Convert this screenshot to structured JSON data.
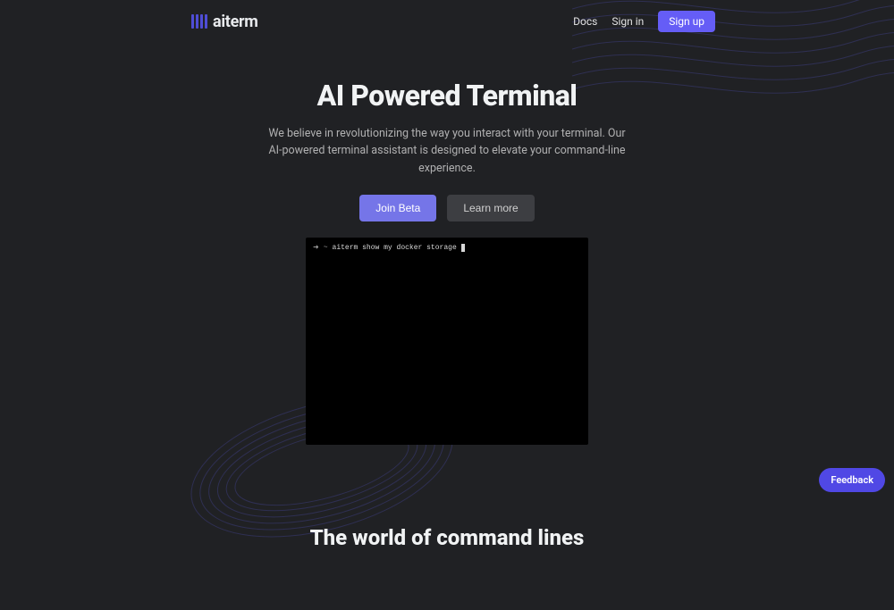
{
  "header": {
    "brand": "aiterm",
    "nav": {
      "docs": "Docs",
      "signin": "Sign in",
      "signup": "Sign up"
    }
  },
  "hero": {
    "title": "AI Powered Terminal",
    "subtitle": "We believe in revolutionizing the way you interact with your terminal. Our AI-powered terminal assistant is designed to elevate your command-line experience.",
    "join_beta": "Join Beta",
    "learn_more": "Learn more"
  },
  "terminal": {
    "arrow": "➜",
    "tilde": "~",
    "command": "aiterm show my docker storage"
  },
  "section2": {
    "title": "The world of command lines"
  },
  "feedback": {
    "label": "Feedback"
  }
}
